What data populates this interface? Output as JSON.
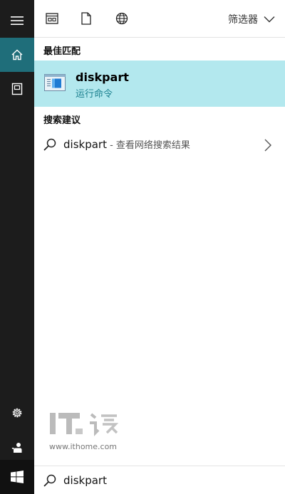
{
  "toolbar": {
    "filter_label": "筛选器"
  },
  "sections": {
    "best_match": "最佳匹配",
    "search_suggestions": "搜索建议"
  },
  "best_match": {
    "title": "diskpart",
    "subtitle": "运行命令"
  },
  "suggestion": {
    "term": "diskpart",
    "suffix": " - 查看网络搜索结果"
  },
  "watermark": {
    "url": "www.ithome.com"
  },
  "search": {
    "value": "diskpart"
  },
  "icons": {
    "menu": "hamburger-menu-icon",
    "home": "home-icon",
    "notebook": "notebook-icon",
    "settings": "gear-icon",
    "feedback": "feedback-icon",
    "windows": "windows-logo-icon",
    "apps": "apps-filter-icon",
    "documents": "document-icon",
    "web": "globe-icon",
    "search": "search-icon",
    "chevron_down": "chevron-down-icon",
    "chevron_right": "chevron-right-icon"
  },
  "colors": {
    "rail": "#1c1c1c",
    "rail_active": "#1f6e7a",
    "highlight": "#b3e8ee",
    "accent_text": "#1a7f8e"
  }
}
